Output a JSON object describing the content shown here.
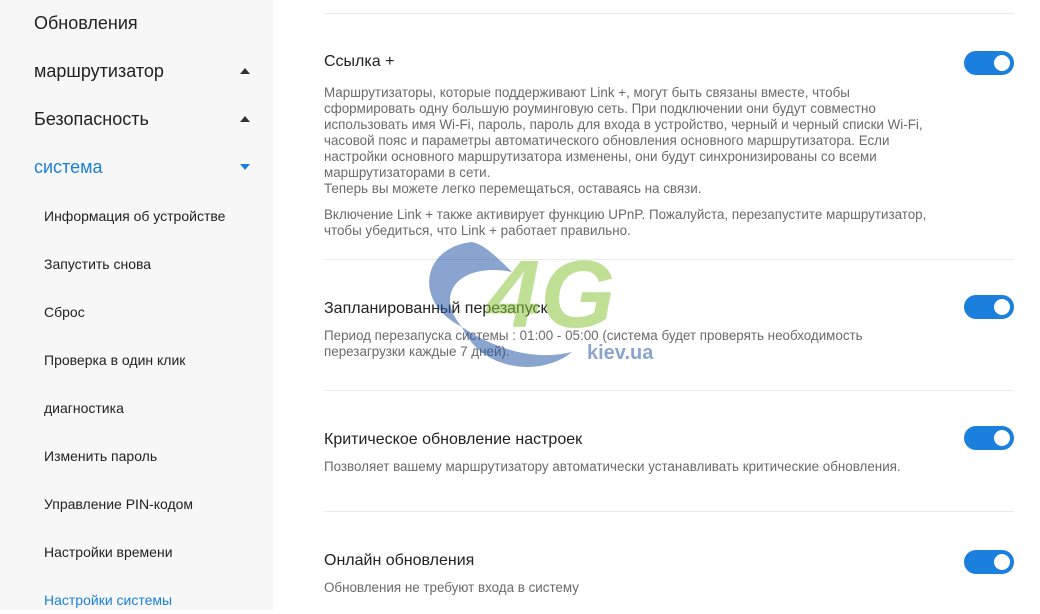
{
  "sidebar": {
    "top_items": [
      {
        "label": "Обновления"
      },
      {
        "label": "маршрутизатор"
      },
      {
        "label": "Безопасность"
      },
      {
        "label": "система"
      }
    ],
    "sub_items": [
      {
        "label": "Информация об устройстве"
      },
      {
        "label": "Запустить снова"
      },
      {
        "label": "Сброс"
      },
      {
        "label": "Проверка в один клик"
      },
      {
        "label": "диагностика"
      },
      {
        "label": "Изменить пароль"
      },
      {
        "label": "Управление PIN-кодом"
      },
      {
        "label": "Настройки времени"
      },
      {
        "label": "Настройки системы"
      }
    ]
  },
  "sections": [
    {
      "title": "Ссылка +",
      "paragraphs": [
        "Маршрутизаторы, которые поддерживают Link +, могут быть связаны вместе, чтобы сформировать одну большую роуминговую сеть. При подключении они будут совместно использовать имя Wi-Fi, пароль, пароль для входа в устройство, черный и черный списки Wi-Fi, часовой пояс и параметры автоматического обновления основного маршрутизатора. Если настройки основного маршрутизатора изменены, они будут синхронизированы со всеми маршрутизаторами в сети.",
        "Теперь вы можете легко перемещаться, оставаясь на связи.",
        "Включение Link + также активирует функцию UPnP. Пожалуйста, перезапустите маршрутизатор, чтобы убедиться, что Link + работает правильно."
      ],
      "enabled": true
    },
    {
      "title": "Запланированный перезапуск",
      "paragraphs": [
        "Период перезапуска системы : 01:00 - 05:00 (система будет проверять необходимость перезагрузки каждые 7 дней)."
      ],
      "enabled": true
    },
    {
      "title": "Критическое обновление настроек",
      "paragraphs": [
        "Позволяет вашему маршрутизатору автоматически устанавливать критические обновления."
      ],
      "enabled": true
    },
    {
      "title": "Онлайн обновления",
      "paragraphs": [
        "Обновления не требуют входа в систему"
      ],
      "enabled": true
    }
  ],
  "watermark": {
    "big": "4G",
    "small": "kiev.ua"
  },
  "colors": {
    "accent": "#1a7fdd",
    "sidebar_bg": "#f7f7f7",
    "text": "#222222",
    "muted": "#6a6a6a"
  }
}
